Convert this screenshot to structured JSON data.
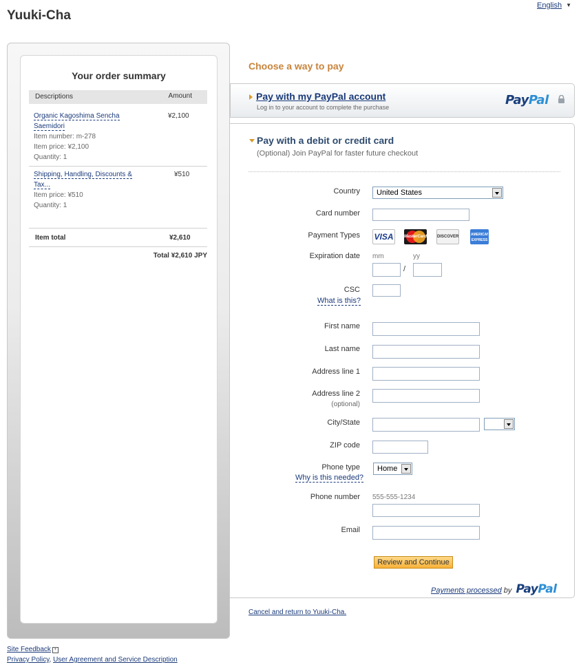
{
  "header": {
    "merchant": "Yuuki-Cha",
    "language": "English"
  },
  "summary": {
    "title": "Your order summary",
    "col_desc": "Descriptions",
    "col_amount": "Amount",
    "items": [
      {
        "name_line1": "Organic Kagoshima Sencha",
        "name_line2": "Saemidori",
        "item_number": "Item number: m-278",
        "item_price": "Item price: ¥2,100",
        "quantity": "Quantity: 1",
        "amount": "¥2,100"
      },
      {
        "name_line1": "Shipping, Handling, Discounts &",
        "name_line2": "Tax...",
        "item_price": "Item price: ¥510",
        "quantity": "Quantity: 1",
        "amount": "¥510"
      }
    ],
    "item_total_label": "Item total",
    "item_total_value": "¥2,610",
    "total": "Total ¥2,610 JPY"
  },
  "main": {
    "choose_title": "Choose a way to pay",
    "paypal_option": {
      "title": "Pay with my PayPal account",
      "subtitle": "Log in to your account to complete the purchase"
    },
    "logo": {
      "pay": "Pay",
      "pal": "Pal"
    },
    "card_option": {
      "title": "Pay with a debit or credit card",
      "subtitle": "(Optional) Join PayPal for faster future checkout"
    }
  },
  "form": {
    "country_label": "Country",
    "country_value": "United States",
    "card_number_label": "Card number",
    "payment_types_label": "Payment Types",
    "card_logos": {
      "visa": "VISA",
      "mastercard": "MasterCard",
      "discover": "DISCOVER",
      "amex": "AMERICAN EXPRESS"
    },
    "expiration_label": "Expiration date",
    "mm_hint": "mm",
    "yy_hint": "yy",
    "exp_separator": "/",
    "csc_label": "CSC",
    "csc_link": "What is this?",
    "first_name_label": "First name",
    "last_name_label": "Last name",
    "address1_label": "Address line 1",
    "address2_label": "Address line 2",
    "address2_optional": "(optional)",
    "city_state_label": "City/State",
    "zip_label": "ZIP code",
    "phone_type_label": "Phone type",
    "phone_type_value": "Home",
    "phone_type_link": "Why is this needed?",
    "phone_number_label": "Phone number",
    "phone_hint": "555-555-1234",
    "email_label": "Email",
    "review_button": "Review and Continue"
  },
  "footer": {
    "payments_processed": "Payments processed",
    "by": "by",
    "cancel_link": "Cancel and return to Yuuki-Cha.",
    "site_feedback": "Site Feedback",
    "privacy_policy": "Privacy Policy",
    "separator": ",",
    "user_agreement": "User Agreement and Service Description"
  },
  "colors": {
    "accent_orange": "#c8843c",
    "link_blue": "#1a3a7a",
    "paypal_dark": "#1a3f7c",
    "paypal_light": "#2d8fd5"
  }
}
